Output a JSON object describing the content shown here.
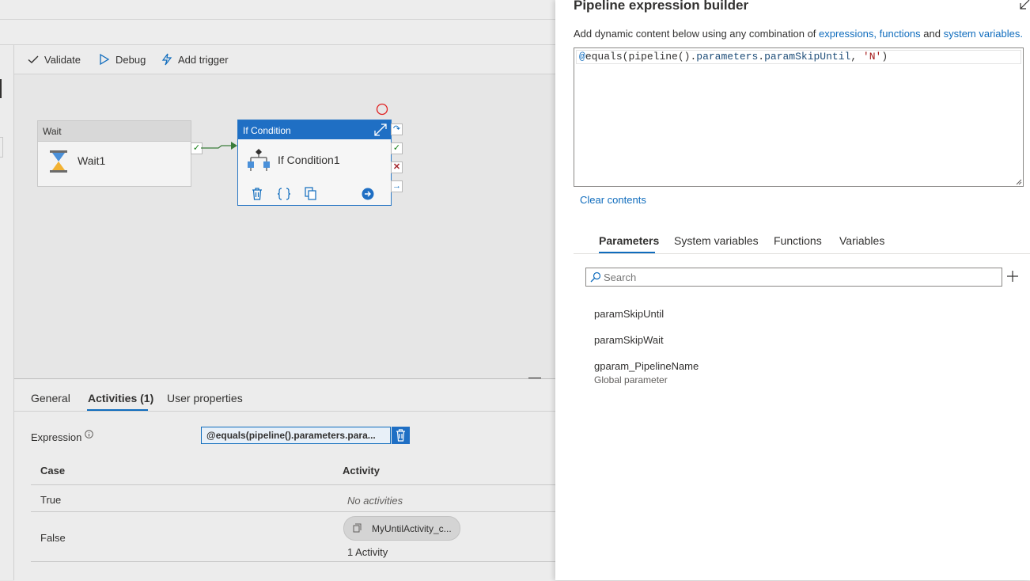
{
  "toolbar": {
    "validate": "Validate",
    "debug": "Debug",
    "add_trigger": "Add trigger"
  },
  "canvas": {
    "wait_activity": {
      "type_label": "Wait",
      "name": "Wait1"
    },
    "if_activity": {
      "type_label": "If Condition",
      "name": "If Condition1"
    }
  },
  "bottom_panel": {
    "tabs": [
      "General",
      "Activities (1)",
      "User properties"
    ],
    "active_tab": "Activities (1)",
    "expression_label": "Expression",
    "expression_value": "@equals(pipeline().parameters.para...",
    "columns": {
      "case": "Case",
      "activity": "Activity"
    },
    "rows": [
      {
        "case": "True",
        "activity_text": "No activities"
      },
      {
        "case": "False",
        "chip": "MyUntilActivity_c...",
        "count": "1 Activity"
      }
    ]
  },
  "builder": {
    "title": "Pipeline expression builder",
    "desc_prefix": "Add dynamic content below using any combination of ",
    "link_expressions": "expressions, functions",
    "desc_and": " and ",
    "link_system_variables": "system variables",
    "desc_suffix": ".",
    "expression": {
      "at": "@",
      "fn": "equals",
      "open": "(",
      "pipeline": "pipeline",
      "mid": "().",
      "parameters": "parameters",
      "dot": ".",
      "param": "paramSkipUntil",
      "comma": ", ",
      "str": "'N'",
      "close": ")"
    },
    "clear_contents": "Clear contents",
    "tabs": [
      "Parameters",
      "System variables",
      "Functions",
      "Variables"
    ],
    "active_tab": "Parameters",
    "search_placeholder": "Search",
    "parameters": [
      {
        "name": "paramSkipUntil"
      },
      {
        "name": "paramSkipWait"
      },
      {
        "name": "gparam_PipelineName",
        "sub": "Global parameter"
      }
    ]
  },
  "colors": {
    "accent": "#0f6cbd",
    "activity_header": "#1f6fc4",
    "success": "#107c10",
    "failure": "#a4262c"
  }
}
